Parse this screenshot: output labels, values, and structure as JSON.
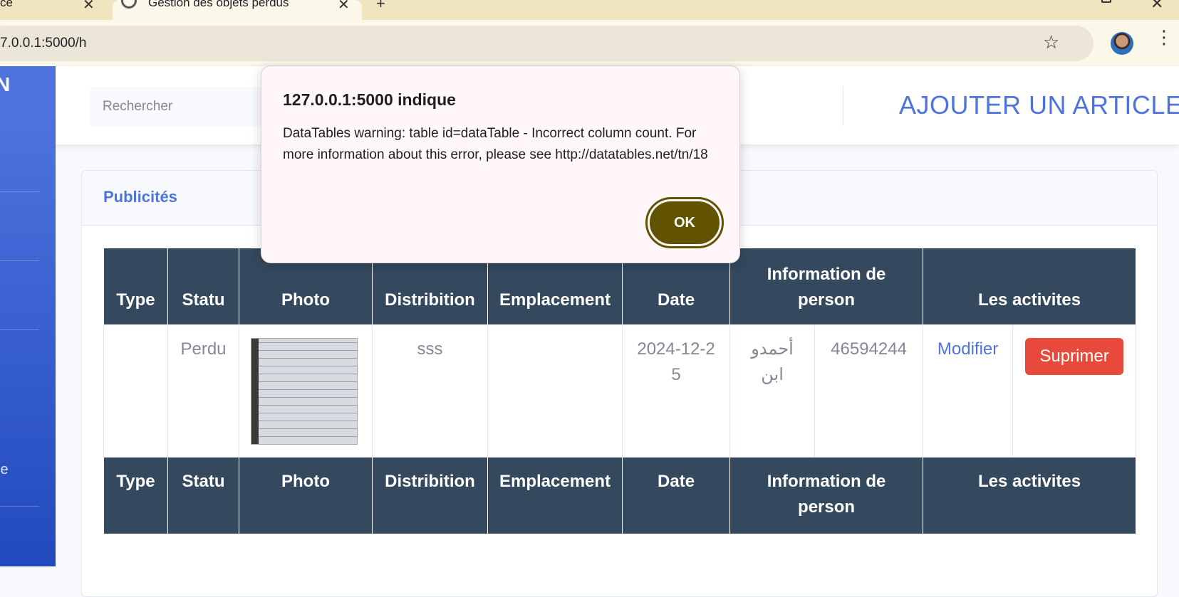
{
  "browser": {
    "tabs": [
      {
        "label": "ce"
      },
      {
        "label": "Gestion des objets perdus"
      }
    ],
    "url": "7.0.0.1:5000/h"
  },
  "sidebar": {
    "brand": "N",
    "partial_label": "le"
  },
  "topbar": {
    "search_placeholder": "Rechercher",
    "add_article_label": "AJOUTER UN ARTICLE"
  },
  "card": {
    "title": "Publicités"
  },
  "table": {
    "headers": [
      "Type",
      "Statu",
      "Photo",
      "Distribition",
      "Emplacement",
      "Date",
      "Information de person",
      "Les activites"
    ],
    "rows": [
      {
        "type": "",
        "statu": "Perdu",
        "distribition": "sss",
        "emplacement": "",
        "date": "2024-12-25",
        "person_name": "أحمدو ابن",
        "person_phone": "46594244",
        "modifier_label": "Modifier",
        "supprimer_label": "Suprimer"
      }
    ]
  },
  "dialog": {
    "title": "127.0.0.1:5000 indique",
    "message": "DataTables warning: table id=dataTable - Incorrect column count. For more information about this error, please see http://datatables.net/tn/18",
    "ok_label": "OK"
  },
  "colors": {
    "primary": "#4e73df",
    "table_header": "#34495e",
    "danger": "#e74a3b",
    "dialog_button": "#625300"
  }
}
